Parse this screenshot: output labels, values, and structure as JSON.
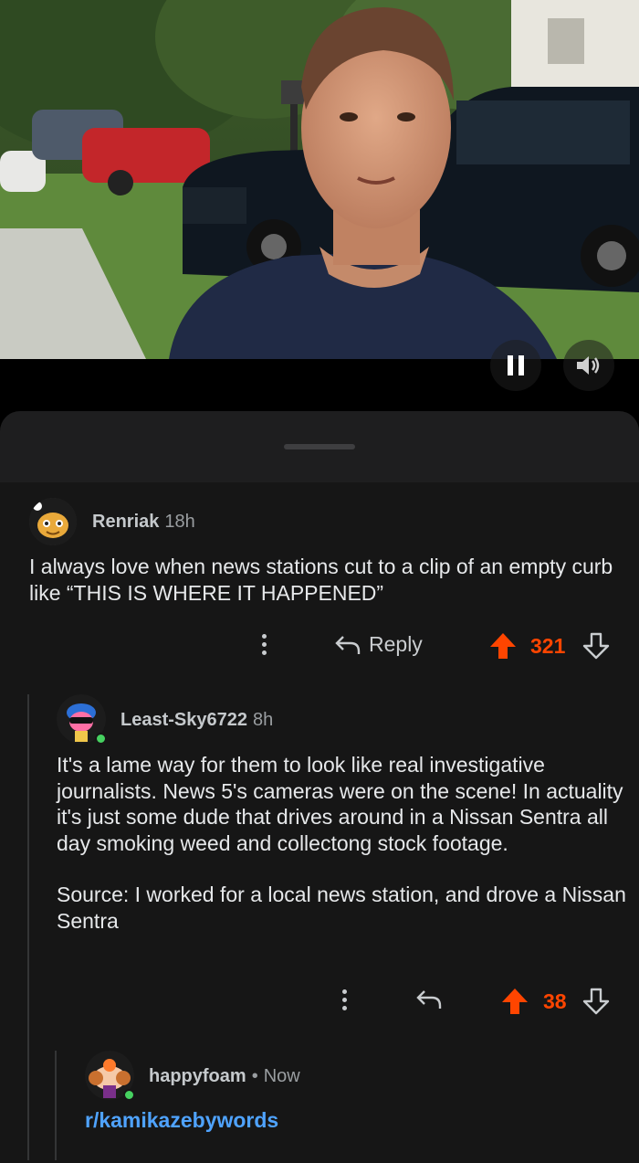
{
  "video": {
    "controls": {
      "pause_icon": "pause-icon",
      "volume_icon": "volume-icon"
    }
  },
  "comments": [
    {
      "username": "Renriak",
      "time": "18h",
      "body": [
        "I always love when news stations cut to a clip of an empty curb like “THIS IS WHERE IT HAPPENED”"
      ],
      "reply_label": "Reply",
      "score": "321",
      "online": false
    },
    {
      "username": "Least-Sky6722",
      "time": "8h",
      "body": [
        "It's a lame way for them to look like real investigative journalists. News 5's cameras were on the scene! In actuality it's just some dude that drives around in a Nissan Sentra all day smoking weed and collectong stock footage.",
        "Source: I worked for a local news station, and drove a Nissan Sentra"
      ],
      "score": "38",
      "online": true
    },
    {
      "username": "happyfoam",
      "separator": "•",
      "time": "Now",
      "body_link": "r/kamikazebywords",
      "online": true
    }
  ],
  "colors": {
    "upvote": "#ff4500",
    "link": "#4fa3ff",
    "online": "#46d160"
  }
}
